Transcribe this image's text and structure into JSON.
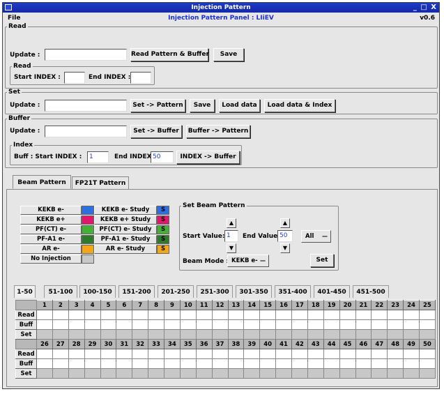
{
  "window": {
    "title": "Injection Pattern",
    "controls": "_ □ X"
  },
  "menubar": {
    "file": "File",
    "panel_title": "Injection Pattern Panel : LIiEV",
    "version": "v0.6"
  },
  "read": {
    "legend": "Read",
    "update_label": "Update :",
    "update_value": "",
    "read_pattern_buffer": "Read Pattern & Buffer",
    "save": "Save",
    "sub": {
      "legend": "Read",
      "start_label": "Start INDEX :",
      "start_value": "",
      "end_label": "End INDEX :",
      "end_value": ""
    }
  },
  "set": {
    "legend": "Set",
    "update_label": "Update :",
    "update_value": "",
    "set_pattern": "Set -> Pattern",
    "save": "Save",
    "load_data": "Load data",
    "load_data_index": "Load data & Index"
  },
  "buffer": {
    "legend": "Buffer",
    "update_label": "Update :",
    "update_value": "",
    "set_buffer": "Set -> Buffer",
    "buffer_pattern": "Buffer -> Pattern",
    "index": {
      "legend": "Index",
      "start_label": "Buff : Start INDEX :",
      "start_value": "1",
      "end_label": "End INDEX :",
      "end_value": "50",
      "button": "INDEX -> Buffer"
    }
  },
  "tabs": [
    "Beam Pattern",
    "FP21T Pattern"
  ],
  "legend_table": {
    "left": [
      {
        "label": "KEKB e-",
        "color": "#2d6fe0"
      },
      {
        "label": "KEKB e+",
        "color": "#e0186c"
      },
      {
        "label": "PF(CT) e-",
        "color": "#44b035"
      },
      {
        "label": "PF-A1 e-",
        "color": "#2f7a2a"
      },
      {
        "label": "AR e-",
        "color": "#f3a718"
      },
      {
        "label": "No Injection",
        "color": "#c8c8c8"
      }
    ],
    "right": [
      {
        "label": "KEKB e- Study",
        "color": "#2d6fe0",
        "mark": "S"
      },
      {
        "label": "KEKB e+ Study",
        "color": "#e0186c",
        "mark": "S"
      },
      {
        "label": "PF(CT) e- Study",
        "color": "#44b035",
        "mark": "S"
      },
      {
        "label": "PF-A1 e- Study",
        "color": "#2f7a2a",
        "mark": "S"
      },
      {
        "label": "AR e- Study",
        "color": "#f3a718",
        "mark": "S"
      }
    ]
  },
  "set_beam": {
    "legend": "Set Beam Pattern",
    "start_label": "Start Value:",
    "start_value": "1",
    "end_label": "End Value:",
    "end_value": "50",
    "mode_all": "All",
    "beam_mode_label": "Beam Mode :",
    "beam_mode_value": "KEKB e-",
    "set_button": "Set",
    "up": "▲",
    "down": "▼",
    "dropdown": "—"
  },
  "range_tabs": [
    "1-50",
    "51-100",
    "100-150",
    "151-200",
    "201-250",
    "251-300",
    "301-350",
    "351-400",
    "401-450",
    "451-500"
  ],
  "grid": {
    "block1": [
      "1",
      "2",
      "3",
      "4",
      "5",
      "6",
      "7",
      "8",
      "9",
      "10",
      "11",
      "12",
      "13",
      "14",
      "15",
      "16",
      "17",
      "18",
      "19",
      "20",
      "21",
      "22",
      "23",
      "24",
      "25"
    ],
    "block2": [
      "26",
      "27",
      "28",
      "29",
      "30",
      "31",
      "32",
      "33",
      "34",
      "35",
      "36",
      "37",
      "38",
      "39",
      "40",
      "41",
      "42",
      "43",
      "44",
      "45",
      "46",
      "47",
      "48",
      "49",
      "50"
    ],
    "rows": [
      "Read",
      "Buff",
      "Set"
    ]
  }
}
